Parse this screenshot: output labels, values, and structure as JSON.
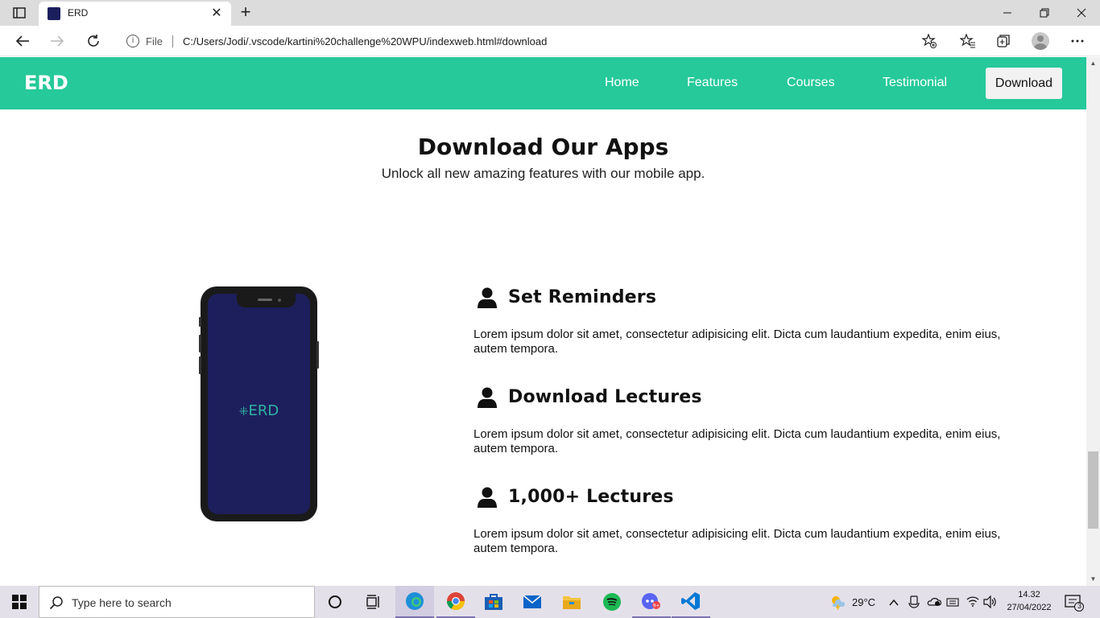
{
  "browser": {
    "tab_title": "ERD",
    "address_prefix": "File",
    "url": "C:/Users/Jodi/.vscode/kartini%20challenge%20WPU/indexweb.html#download"
  },
  "site": {
    "logo": "ERD",
    "nav": [
      "Home",
      "Features",
      "Courses",
      "Testimonial"
    ],
    "nav_download": "Download",
    "accent_color": "#26c99a"
  },
  "section": {
    "title": "Download Our Apps",
    "subtitle": "Unlock all new amazing features with our mobile app.",
    "phone_logo": "ERD"
  },
  "features": [
    {
      "title": "Set Reminders",
      "desc": "Lorem ipsum dolor sit amet, consectetur adipisicing elit. Dicta cum laudantium expedita, enim eius, autem tempora.",
      "icon": "user-icon"
    },
    {
      "title": "Download Lectures",
      "desc": "Lorem ipsum dolor sit amet, consectetur adipisicing elit. Dicta cum laudantium expedita, enim eius, autem tempora.",
      "icon": "user-icon"
    },
    {
      "title": "1,000+ Lectures",
      "desc": "Lorem ipsum dolor sit amet, consectetur adipisicing elit. Dicta cum laudantium expedita, enim eius, autem tempora.",
      "icon": "user-icon"
    }
  ],
  "taskbar": {
    "search_placeholder": "Type here to search",
    "temperature": "29°C",
    "time": "14.32",
    "date": "27/04/2022",
    "notification_count": "3"
  }
}
